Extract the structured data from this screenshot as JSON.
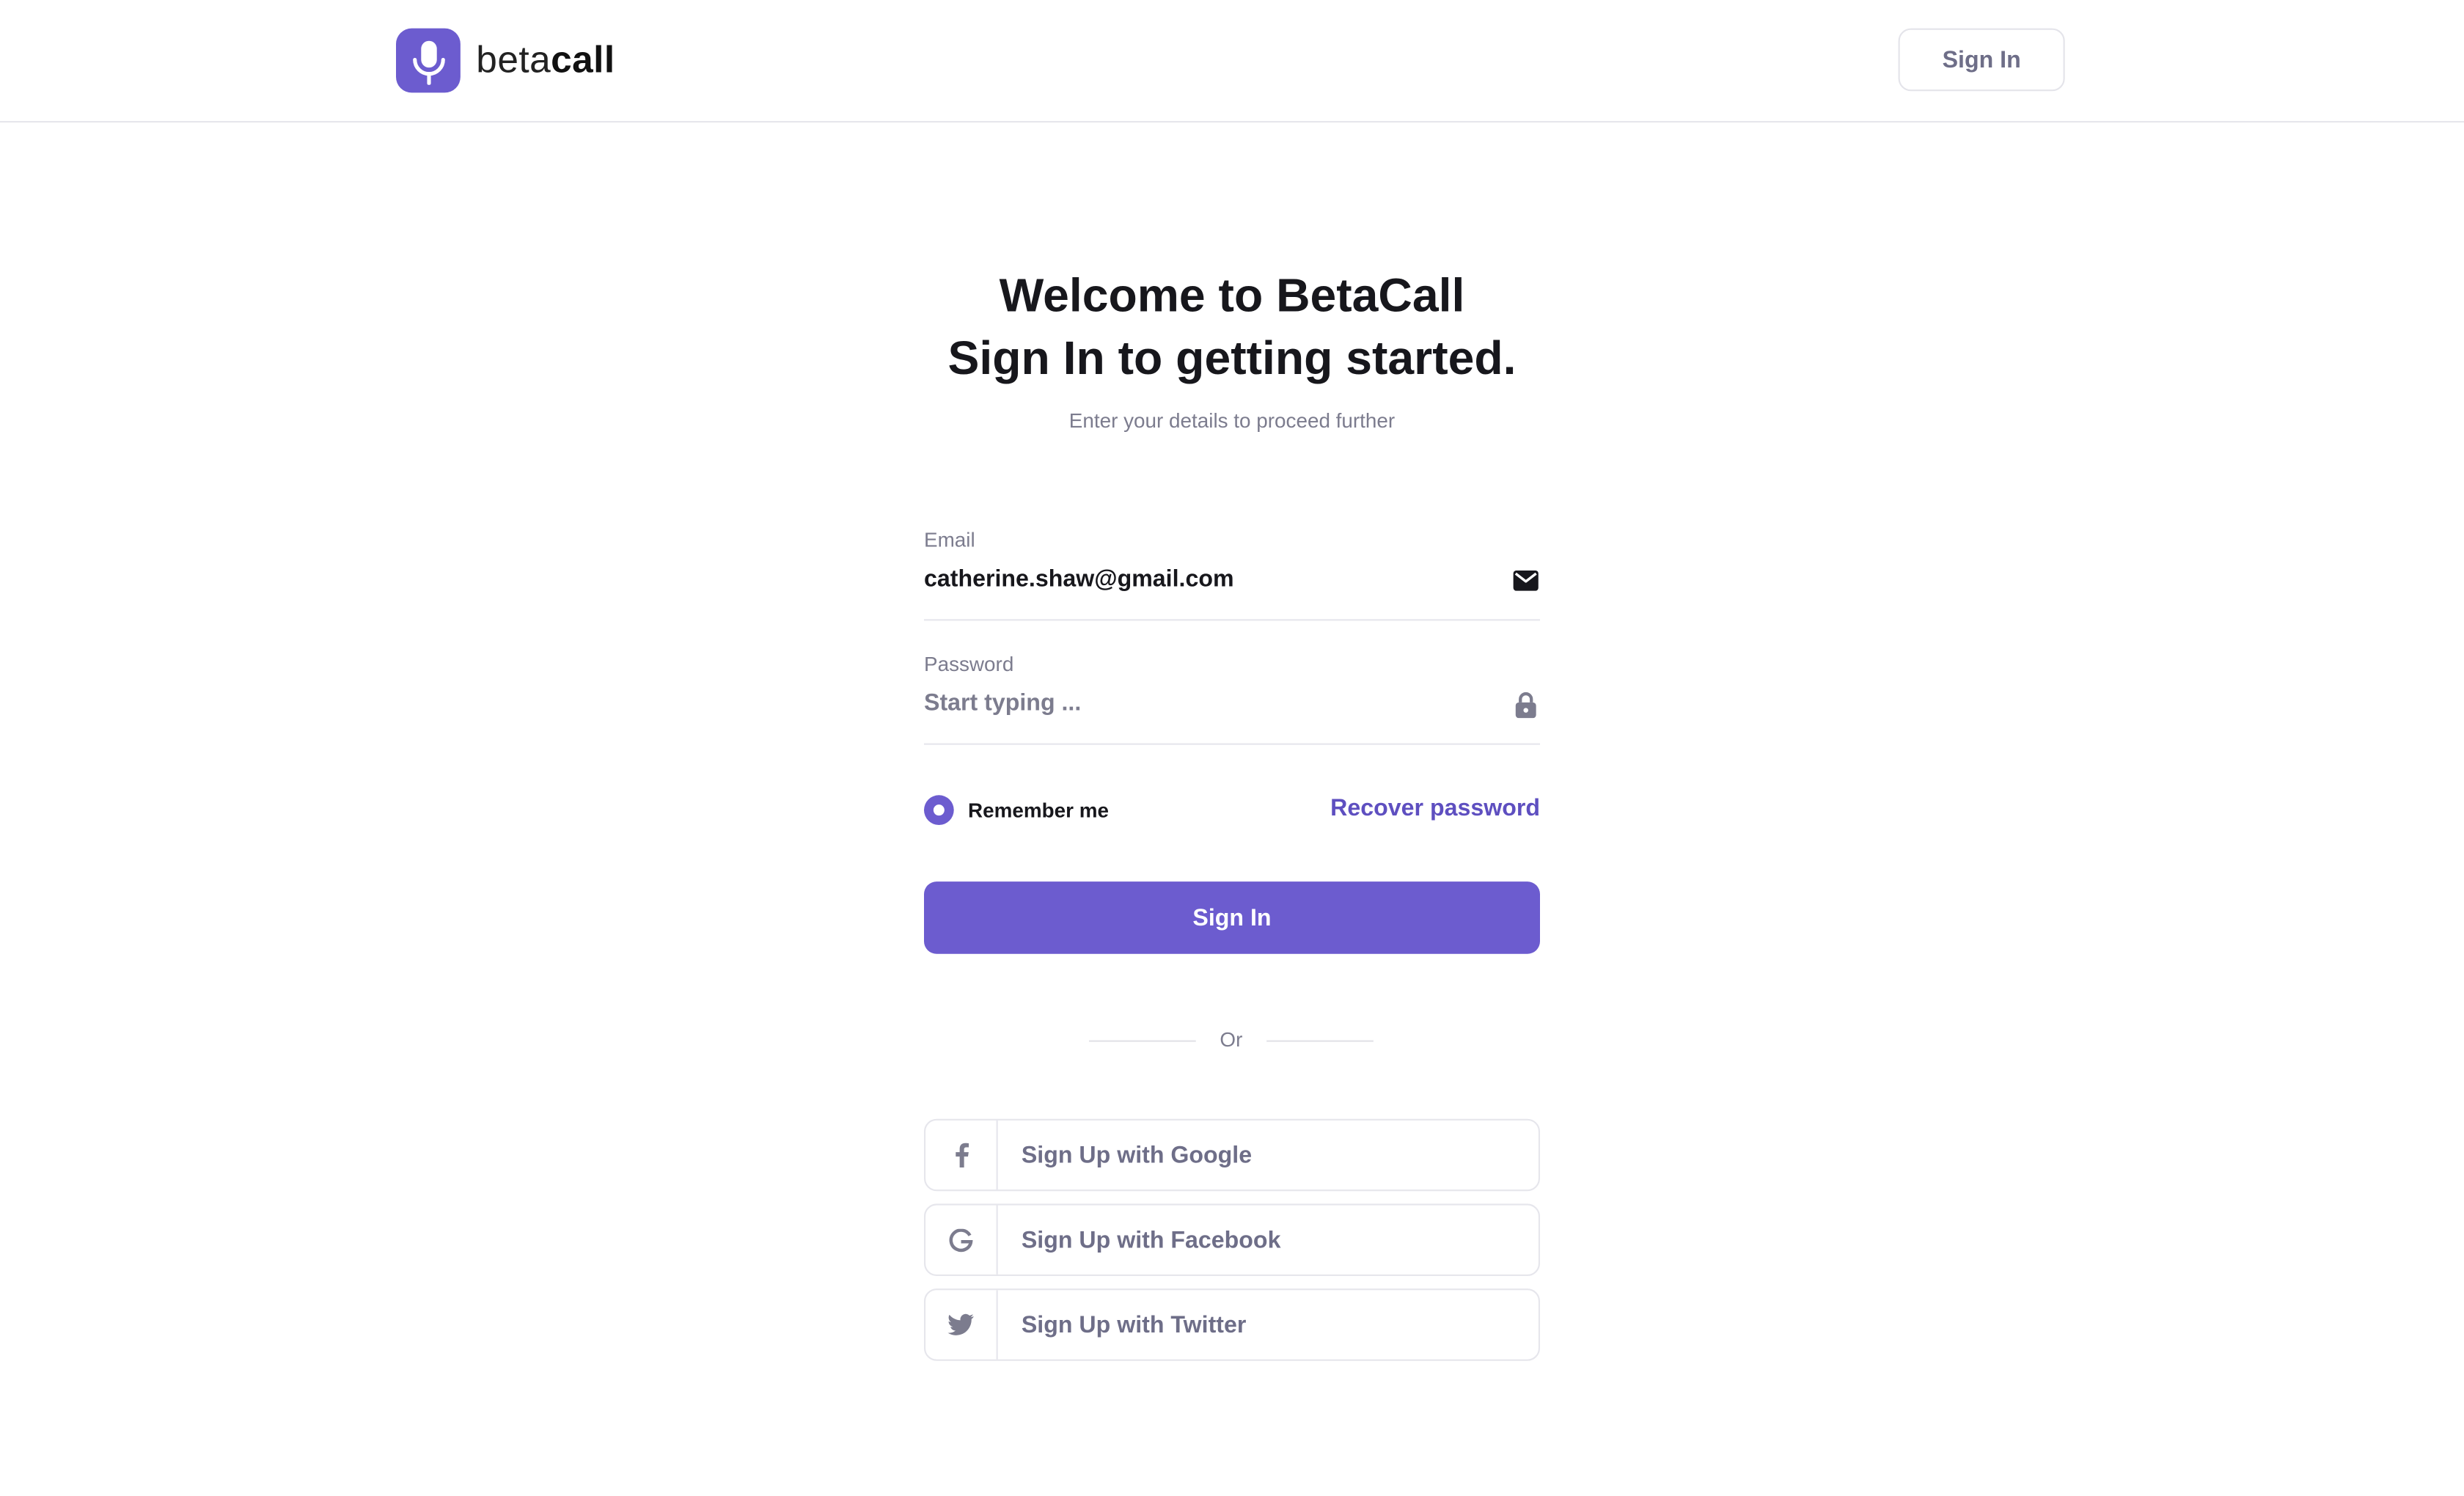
{
  "header": {
    "logo": {
      "text_light": "beta",
      "text_bold": "call",
      "icon": "microphone-icon"
    },
    "signin_label": "Sign In"
  },
  "hero": {
    "title_line1": "Welcome to BetaCall",
    "title_line2": "Sign In to getting started.",
    "subtitle": "Enter your details to proceed further"
  },
  "form": {
    "email": {
      "label": "Email",
      "value": "catherine.shaw@gmail.com",
      "icon": "envelope-icon"
    },
    "password": {
      "label": "Password",
      "placeholder": "Start typing ...",
      "icon": "lock-icon"
    },
    "remember_label": "Remember me",
    "remember_checked": true,
    "recover_label": "Recover password",
    "submit_label": "Sign In",
    "divider_label": "Or"
  },
  "social": [
    {
      "label": "Sign Up with Google",
      "icon": "facebook-icon"
    },
    {
      "label": "Sign Up with Facebook",
      "icon": "google-icon"
    },
    {
      "label": "Sign Up with Twitter",
      "icon": "twitter-icon"
    }
  ],
  "colors": {
    "accent": "#6c5ccf",
    "link": "#5e4fc0",
    "muted": "#7c7c8e",
    "text": "#17171c"
  }
}
